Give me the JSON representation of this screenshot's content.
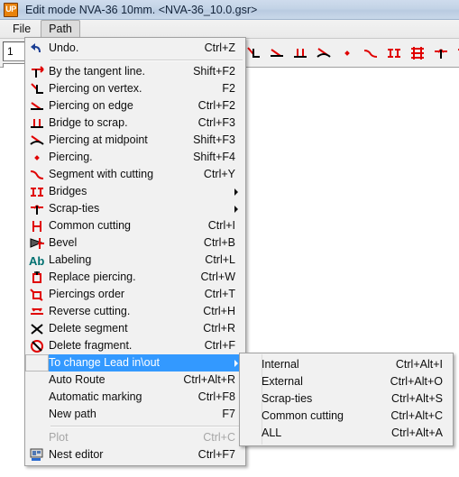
{
  "window": {
    "app_icon": "up-logo-icon",
    "app_icon_text": "UP",
    "title": "Edit mode   NVA-36 10mm. <NVA-36_10.0.gsr>"
  },
  "menubar": {
    "items": [
      {
        "label": "File",
        "open": false
      },
      {
        "label": "Path",
        "open": true
      }
    ]
  },
  "toolbar": {
    "count_field_value": "1",
    "icons": [
      "piercing-on-vertex-icon",
      "piercing-on-edge-icon",
      "bridge-to-scrap-icon",
      "piercing-at-midpoint-icon",
      "piercing-icon",
      "segment-with-cutting-icon",
      "bridges-icon",
      "common-cutting-grid-icon",
      "scrap-ties-icon",
      "bevel-icon"
    ]
  },
  "path_menu": {
    "items": [
      {
        "label": "Undo.",
        "accel": "Ctrl+Z",
        "icon": "undo-icon",
        "type": "item"
      },
      {
        "type": "separator"
      },
      {
        "label": "By the tangent line.",
        "accel": "Shift+F2",
        "icon": "tangent-line-icon",
        "type": "item"
      },
      {
        "label": "Piercing on vertex.",
        "accel": "F2",
        "icon": "piercing-on-vertex-icon",
        "type": "item"
      },
      {
        "label": "Piercing on edge",
        "accel": "Ctrl+F2",
        "icon": "piercing-on-edge-icon",
        "type": "item"
      },
      {
        "label": "Bridge to scrap.",
        "accel": "Ctrl+F3",
        "icon": "bridge-to-scrap-icon",
        "type": "item"
      },
      {
        "label": "Piercing at midpoint",
        "accel": "Shift+F3",
        "icon": "piercing-at-midpoint-icon",
        "type": "item"
      },
      {
        "label": "Piercing.",
        "accel": "Shift+F4",
        "icon": "piercing-icon",
        "type": "item"
      },
      {
        "label": "Segment with cutting",
        "accel": "Ctrl+Y",
        "icon": "segment-with-cutting-icon",
        "type": "item"
      },
      {
        "label": "Bridges",
        "accel": "",
        "icon": "bridges-icon",
        "type": "submenu"
      },
      {
        "label": "Scrap-ties",
        "accel": "",
        "icon": "scrap-ties-icon",
        "type": "submenu"
      },
      {
        "label": "Common cutting",
        "accel": "Ctrl+I",
        "icon": "common-cutting-icon",
        "type": "item"
      },
      {
        "label": "Bevel",
        "accel": "Ctrl+B",
        "icon": "bevel-icon",
        "type": "item"
      },
      {
        "label": "Labeling",
        "accel": "Ctrl+L",
        "icon": "labeling-ab-icon",
        "type": "item"
      },
      {
        "label": "Replace piercing.",
        "accel": "Ctrl+W",
        "icon": "replace-piercing-icon",
        "type": "item"
      },
      {
        "label": "Piercings order",
        "accel": "Ctrl+T",
        "icon": "piercings-order-icon",
        "type": "item"
      },
      {
        "label": "Reverse cutting.",
        "accel": "Ctrl+H",
        "icon": "reverse-cutting-icon",
        "type": "item"
      },
      {
        "label": "Delete segment",
        "accel": "Ctrl+R",
        "icon": "delete-segment-icon",
        "type": "item"
      },
      {
        "label": "Delete fragment.",
        "accel": "Ctrl+F",
        "icon": "delete-fragment-icon",
        "type": "item"
      },
      {
        "label": "To change Lead in\\out",
        "accel": "",
        "icon": "lead-in-out-icon",
        "type": "submenu",
        "highlighted": true
      },
      {
        "label": "Auto Route",
        "accel": "Ctrl+Alt+R",
        "icon": "",
        "type": "item"
      },
      {
        "label": "Automatic marking",
        "accel": "Ctrl+F8",
        "icon": "",
        "type": "item"
      },
      {
        "label": "New path",
        "accel": "F7",
        "icon": "",
        "type": "item"
      },
      {
        "type": "separator"
      },
      {
        "label": "Plot",
        "accel": "Ctrl+C",
        "icon": "",
        "type": "item",
        "disabled": true
      },
      {
        "label": "Nest editor",
        "accel": "Ctrl+F7",
        "icon": "nest-editor-icon",
        "type": "item"
      }
    ]
  },
  "lead_submenu": {
    "items": [
      {
        "label": "Internal",
        "accel": "Ctrl+Alt+I"
      },
      {
        "label": "External",
        "accel": "Ctrl+Alt+O"
      },
      {
        "label": "Scrap-ties",
        "accel": "Ctrl+Alt+S"
      },
      {
        "label": "Common cutting",
        "accel": "Ctrl+Alt+C"
      },
      {
        "label": "ALL",
        "accel": "Ctrl+Alt+A"
      }
    ]
  },
  "colors": {
    "highlight": "#3399ff",
    "menu_bg": "#f1f1f1",
    "icon_red": "#e00000",
    "icon_black": "#000000",
    "icon_teal": "#008080",
    "title_bar": "#c3d3e6",
    "app_icon_orange": "#e8820c"
  }
}
